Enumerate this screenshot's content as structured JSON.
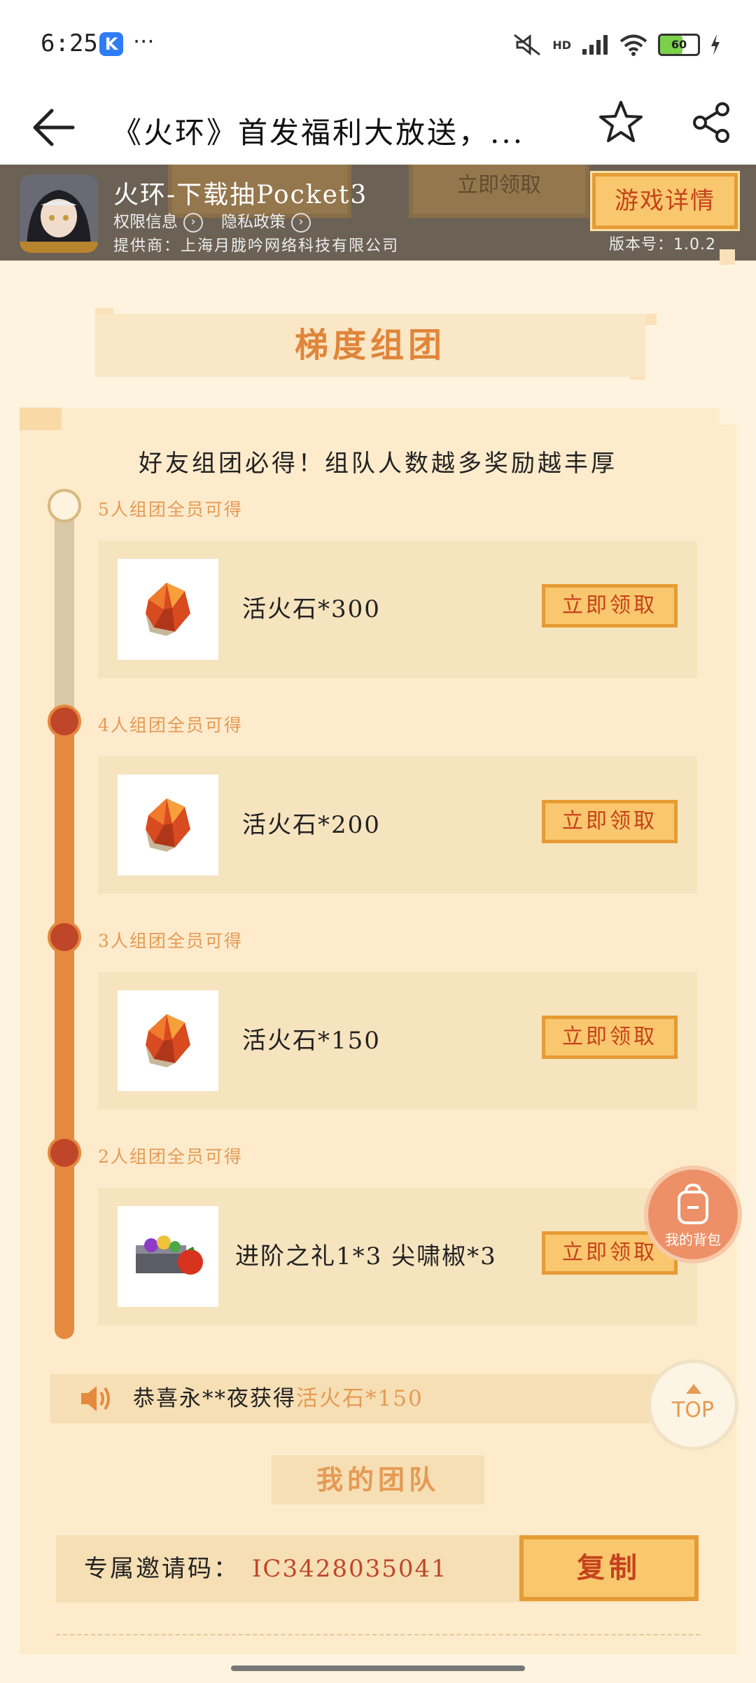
{
  "status_bar": {
    "time": "6:25",
    "app_badge": "K",
    "more": "···",
    "network": "HD",
    "battery": "60"
  },
  "title_bar": {
    "title": "《火环》首发福利大放送，..."
  },
  "game": {
    "name": "火环-下载抽Pocket3",
    "permissions": "权限信息",
    "privacy": "隐私政策",
    "provider": "提供商：上海月胧吟网络科技有限公司",
    "detail_button": "游戏详情",
    "version": "版本号：1.0.2",
    "background_button": "立即领取"
  },
  "section": {
    "title": "梯度组团"
  },
  "team": {
    "slogan": "好友组团必得！组队人数越多奖励越丰厚",
    "tiers": [
      {
        "label": "5人组团全员可得",
        "reward": "活火石*300",
        "button": "立即领取",
        "icon": "fire-stone-icon"
      },
      {
        "label": "4人组团全员可得",
        "reward": "活火石*200",
        "button": "立即领取",
        "icon": "fire-stone-icon"
      },
      {
        "label": "3人组团全员可得",
        "reward": "活火石*150",
        "button": "立即领取",
        "icon": "fire-stone-icon"
      },
      {
        "label": "2人组团全员可得",
        "reward": "进阶之礼1*3   尖啸椒*3",
        "button": "立即领取",
        "icon": "gift-chest-icon"
      }
    ]
  },
  "notice": {
    "prefix": "恭喜永**夜获得",
    "item": "活火石*150"
  },
  "my_team": {
    "title": "我的团队",
    "invite_label": "专属邀请码：",
    "invite_code": "IC3428035041",
    "copy_button": "复制"
  },
  "floating": {
    "bag_label": "我的背包",
    "top_label": "TOP"
  },
  "colors": {
    "accent": "#e5893e",
    "button_fill": "#f9c76d",
    "button_text": "#c6421d",
    "page_bg": "#fdf3df"
  }
}
